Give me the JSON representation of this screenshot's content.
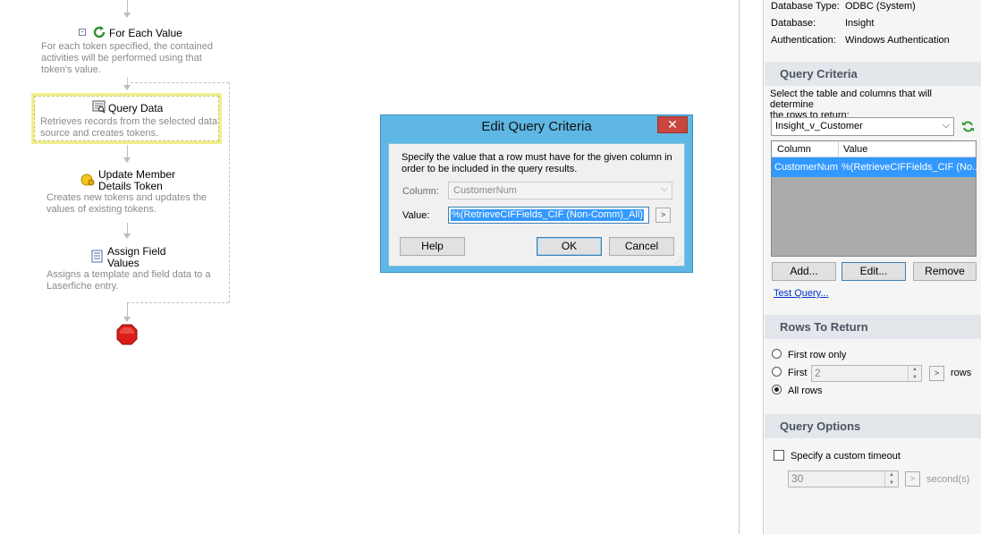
{
  "workflow": {
    "for_each": {
      "title": "For Each Value",
      "desc_lines": [
        "For each token specified, the contained",
        "activities will be performed using that",
        "token's value."
      ]
    },
    "query_data": {
      "title": "Query Data",
      "desc_lines": [
        "Retrieves records from the selected data",
        "source and creates tokens."
      ]
    },
    "update_token": {
      "title_lines": [
        "Update Member",
        "Details Token"
      ],
      "desc_lines": [
        "Creates new tokens and updates the",
        "values of existing tokens."
      ]
    },
    "assign_fields": {
      "title_lines": [
        "Assign Field",
        "Values"
      ],
      "desc_lines": [
        "Assigns a template and field data to a",
        "Laserfiche entry."
      ]
    }
  },
  "dialog": {
    "title": "Edit Query Criteria",
    "close_label": "✕",
    "instruction_lines": [
      "Specify the value that a row must have for the given column in",
      "order to be included in the query results."
    ],
    "column_label": "Column:",
    "column_value": "CustomerNum",
    "value_label": "Value:",
    "value_text": "%(RetrieveCIFFields_CIF (Non-Comm)_All)",
    "token_button": ">",
    "help_label": "Help",
    "ok_label": "OK",
    "cancel_label": "Cancel"
  },
  "panel": {
    "db_info": [
      {
        "label": "Database Type:",
        "value": "ODBC (System)"
      },
      {
        "label": "Database:",
        "value": "Insight"
      },
      {
        "label": "Authentication:",
        "value": "Windows Authentication"
      }
    ],
    "query_criteria": {
      "header": "Query Criteria",
      "description_lines": [
        "Select the table and columns that will determine",
        "the rows to return:"
      ],
      "table_select": "Insight_v_Customer",
      "grid_headers": [
        "Column",
        "Value"
      ],
      "grid_rows": [
        {
          "column": "CustomerNum",
          "value": "%(RetrieveCIFFields_CIF (No..."
        }
      ],
      "add_label": "Add...",
      "edit_label": "Edit...",
      "remove_label": "Remove",
      "test_query_label": "Test Query..."
    },
    "rows_to_return": {
      "header": "Rows To Return",
      "first_row_only": "First row only",
      "first_label": "First",
      "first_value": "2",
      "rows_suffix": "rows",
      "all_rows": "All rows",
      "token_button": ">"
    },
    "query_options": {
      "header": "Query Options",
      "custom_timeout_label": "Specify a custom timeout",
      "timeout_value": "30",
      "seconds_label": "second(s)",
      "token_button": ">"
    }
  },
  "colors": {
    "dialog_frame": "#5eb7e4",
    "close_button": "#c7463e",
    "selection": "#3399ff",
    "header_text": "#4b5561",
    "link": "#0033cc"
  }
}
